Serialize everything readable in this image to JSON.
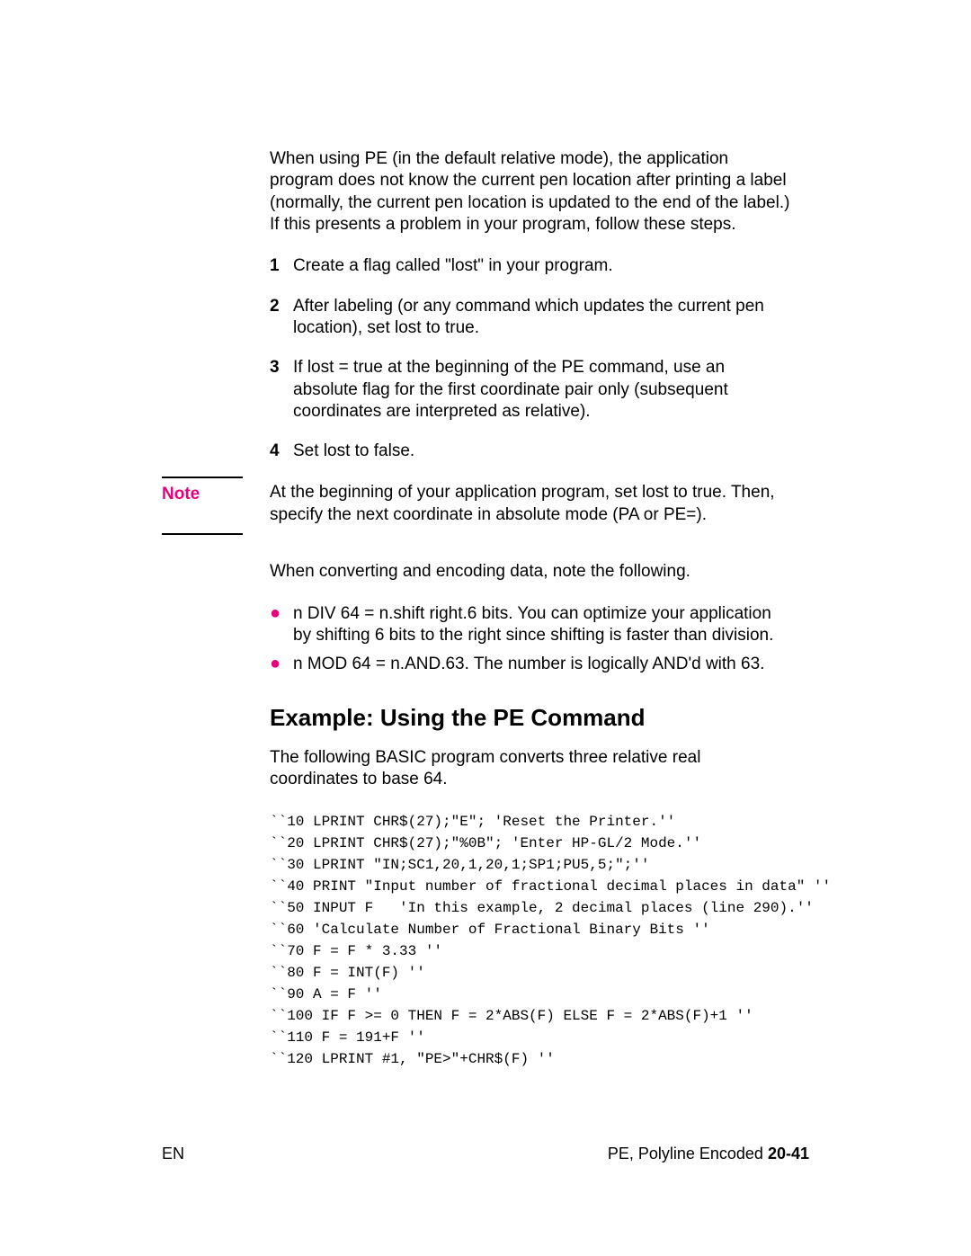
{
  "intro": "When using PE (in the default relative mode), the application program does not know the current pen location after printing a label (normally, the current pen location is updated to the end of the label.) If this presents a problem in your program, follow these steps.",
  "steps": [
    "Create a flag called \"lost\" in your program.",
    "After labeling (or any command which updates the current pen location), set lost to true.",
    "If lost = true at the beginning of the PE command, use an absolute flag for the first coordinate pair only (subsequent coordinates are interpreted as relative).",
    "Set lost to false."
  ],
  "note": {
    "label": "Note",
    "text": "At the beginning of your application program, set lost to true. Then, specify the next coordinate in absolute mode (PA or PE=)."
  },
  "converting_intro": "When converting and encoding data, note the following.",
  "bullets": [
    "n DIV 64 = n.shift right.6 bits. You can optimize your application by shifting 6 bits to the right since shifting is faster than division.",
    "n MOD 64 = n.AND.63. The number is logically AND'd with 63."
  ],
  "example": {
    "heading": "Example: Using the PE Command",
    "intro": "The following BASIC program converts three relative real coordinates to base 64.",
    "code": [
      "``10 LPRINT CHR$(27);\"E\"; 'Reset the Printer.''",
      "``20 LPRINT CHR$(27);\"%0B\"; 'Enter HP-GL/2 Mode.''",
      "``30 LPRINT \"IN;SC1,20,1,20,1;SP1;PU5,5;\";''",
      "``40 PRINT \"Input number of fractional decimal places in data\" ''",
      "``50 INPUT F   'In this example, 2 decimal places (line 290).''",
      "``60 'Calculate Number of Fractional Binary Bits ''",
      "``70 F = F * 3.33 ''",
      "``80 F = INT(F) ''",
      "``90 A = F ''",
      "``100 IF F >= 0 THEN F = 2*ABS(F) ELSE F = 2*ABS(F)+1 ''",
      "``110 F = 191+F ''",
      "``120 LPRINT #1, \"PE>\"+CHR$(F) ''"
    ]
  },
  "footer": {
    "left": "EN",
    "right_text": "PE, Polyline Encoded ",
    "right_page": "20-41"
  }
}
